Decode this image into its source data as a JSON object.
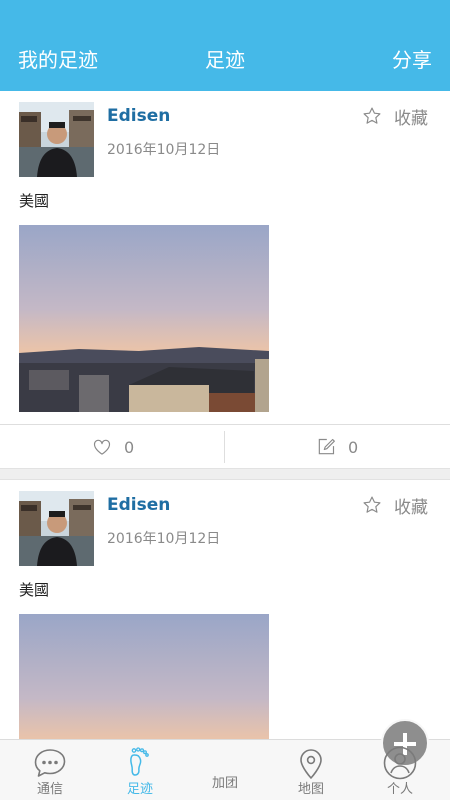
{
  "header": {
    "left_label": "我的足迹",
    "title": "足迹",
    "right_label": "分享"
  },
  "posts": [
    {
      "author": "Edisen",
      "date": "2016年10月12日",
      "favorite_label": "收藏",
      "location": "美國",
      "likes": "0",
      "comments": "0"
    },
    {
      "author": "Edisen",
      "date": "2016年10月12日",
      "favorite_label": "收藏",
      "location": "美國"
    }
  ],
  "tabs": [
    {
      "label": "通信",
      "icon": "chat-bubble-icon",
      "active": false
    },
    {
      "label": "足迹",
      "icon": "footprint-icon",
      "active": true
    },
    {
      "label": "加团",
      "icon": "plus-icon",
      "active": false
    },
    {
      "label": "地图",
      "icon": "map-pin-icon",
      "active": false
    },
    {
      "label": "个人",
      "icon": "person-icon",
      "active": false
    }
  ],
  "colors": {
    "accent": "#45b9e8",
    "author": "#1f6ea3",
    "muted": "#8a8a8a"
  }
}
